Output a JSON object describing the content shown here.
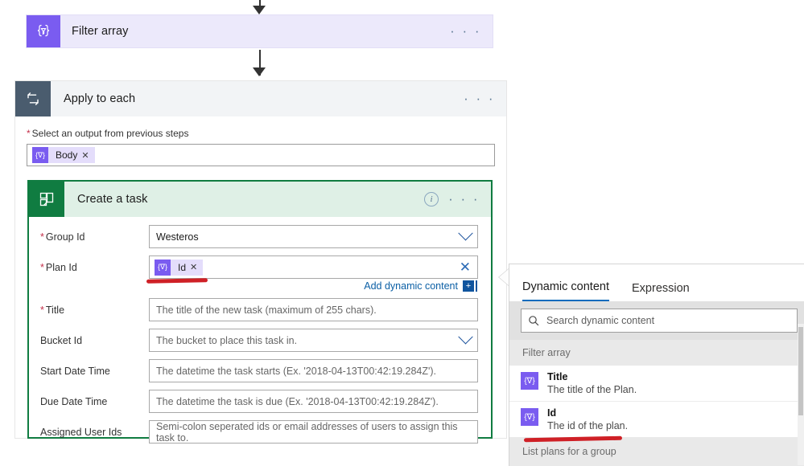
{
  "flow": {
    "filter_array": {
      "title": "Filter array",
      "icon": "expression-braces-filter-icon",
      "icon_glyph": "{∇}",
      "menu": "· · ·",
      "accent": "#7a5cf0"
    },
    "apply_to_each": {
      "title": "Apply to each",
      "icon": "loop-repeat-icon",
      "menu": "· · ·",
      "accent": "#4a5c6e",
      "output_field": {
        "label": "Select an output from previous steps",
        "required_marker": "*",
        "token": {
          "text": "Body",
          "remove": "✕",
          "glyph": "{∇}"
        }
      }
    },
    "create_task": {
      "title": "Create a task",
      "icon": "microsoft-planner-icon",
      "info": "i",
      "menu": "· · ·",
      "accent": "#107c41",
      "fields": [
        {
          "label": "Group Id",
          "required": true,
          "value": "Westeros",
          "placeholder": "",
          "control": "dropdown"
        },
        {
          "label": "Plan Id",
          "required": true,
          "value": "",
          "placeholder": "",
          "control": "token",
          "token": {
            "text": "Id",
            "remove": "✕",
            "glyph": "{∇}"
          },
          "clear": "✕"
        },
        {
          "label": "Title",
          "required": true,
          "value": "",
          "placeholder": "The title of the new task (maximum of 255 chars).",
          "control": "text"
        },
        {
          "label": "Bucket Id",
          "required": false,
          "value": "",
          "placeholder": "The bucket to place this task in.",
          "control": "dropdown"
        },
        {
          "label": "Start Date Time",
          "required": false,
          "value": "",
          "placeholder": "The datetime the task starts (Ex. '2018-04-13T00:42:19.284Z').",
          "control": "text"
        },
        {
          "label": "Due Date Time",
          "required": false,
          "value": "",
          "placeholder": "The datetime the task is due (Ex. '2018-04-13T00:42:19.284Z').",
          "control": "text"
        },
        {
          "label": "Assigned User Ids",
          "required": false,
          "value": "",
          "placeholder": "Semi-colon seperated ids or email addresses of users to assign this task to.",
          "control": "text"
        }
      ],
      "add_dynamic_content": {
        "label": "Add dynamic content",
        "icon": "add-plus-icon",
        "icon_glyph": "+"
      }
    }
  },
  "dynamic_panel": {
    "tabs": [
      {
        "label": "Dynamic content",
        "active": true
      },
      {
        "label": "Expression",
        "active": false
      }
    ],
    "search": {
      "placeholder": "Search dynamic content",
      "icon": "search-icon",
      "value": ""
    },
    "groups": [
      {
        "name": "Filter array",
        "items": [
          {
            "name": "Title",
            "description": "The title of the Plan.",
            "glyph": "{∇}"
          },
          {
            "name": "Id",
            "description": "The id of the plan.",
            "glyph": "{∇}"
          }
        ]
      },
      {
        "name": "List plans for a group",
        "items": []
      }
    ]
  },
  "annotations": {
    "color": "#cf2026",
    "marks": [
      {
        "name": "underline-plan-id-field"
      },
      {
        "name": "underline-dynamic-id-item"
      }
    ]
  }
}
